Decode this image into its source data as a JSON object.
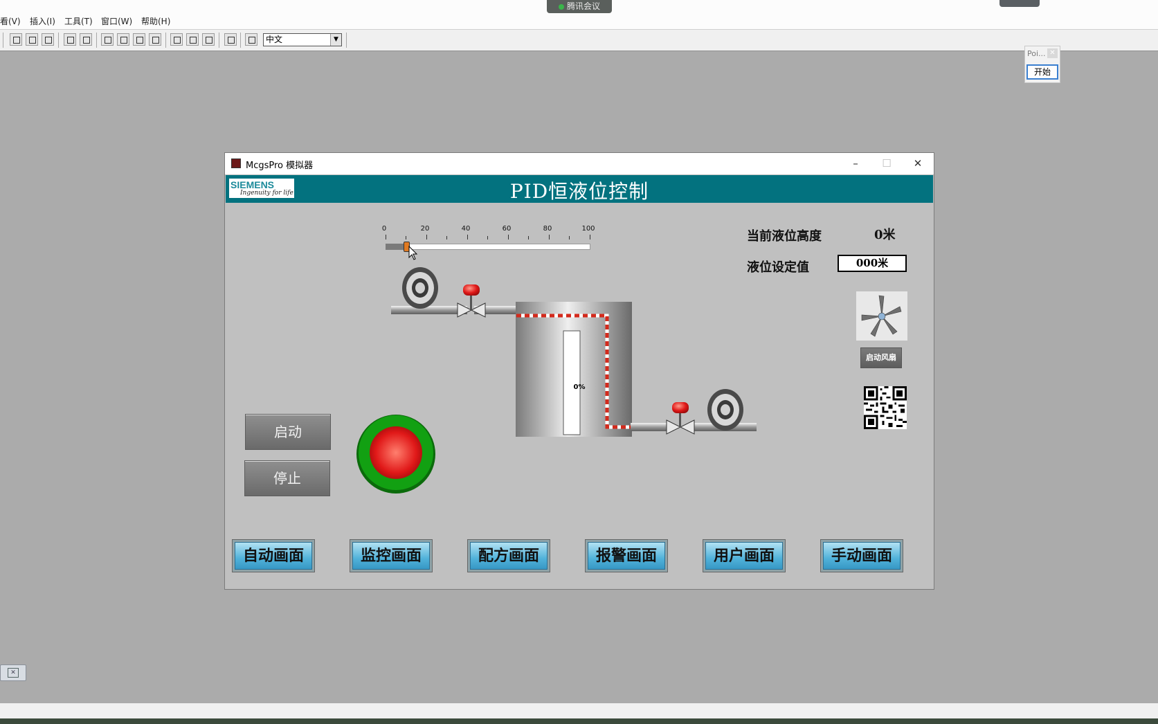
{
  "app_menu": [
    "看(V)",
    "插入(I)",
    "工具(T)",
    "窗口(W)",
    "帮助(H)"
  ],
  "meeting_widget": {
    "label": "腾讯会议"
  },
  "toolbar": {
    "language_value": "中文"
  },
  "poi_dialog": {
    "title": "Poi...",
    "start_label": "开始"
  },
  "simulator": {
    "window_title": "McgsPro 模拟器",
    "controls": {
      "minimize": "–",
      "maximize": "☐",
      "close": "✕"
    },
    "logo": {
      "brand": "SIEMENS",
      "slogan": "Ingenuity for life"
    },
    "screen_title": "PID恒液位控制",
    "slider": {
      "tick_labels": [
        "0",
        "20",
        "40",
        "60",
        "80",
        "100"
      ],
      "value_percent": 10
    },
    "readouts": {
      "current_level_label": "当前液位高度",
      "current_level_value": "0米",
      "setpoint_label": "液位设定值",
      "setpoint_value": "000米"
    },
    "tank": {
      "fill_percent_label": "0%",
      "fill_fraction": 0.0
    },
    "fan_button_label": "启动风扇",
    "start_button_label": "启动",
    "stop_button_label": "停止",
    "indicator_color": "#e01818",
    "nav_buttons": [
      "自动画面",
      "监控画面",
      "配方画面",
      "报警画面",
      "用户画面",
      "手动画面"
    ],
    "colors": {
      "header": "#03727f",
      "flow_line": "#d42a1c",
      "nav_accent": "#51b2da"
    }
  }
}
